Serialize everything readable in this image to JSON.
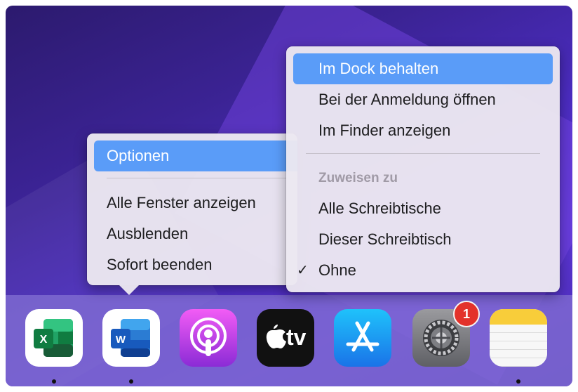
{
  "context_menu": {
    "options_label": "Optionen",
    "items": [
      "Alle Fenster anzeigen",
      "Ausblenden",
      "Sofort beenden"
    ]
  },
  "submenu": {
    "items": [
      "Im Dock behalten",
      "Bei der Anmeldung öffnen",
      "Im Finder anzeigen"
    ],
    "assign_header": "Zuweisen zu",
    "assign_items": [
      "Alle Schreibtische",
      "Dieser Schreibtisch",
      "Ohne"
    ],
    "checked_item": "Ohne"
  },
  "dock": {
    "apps": [
      {
        "name": "Excel",
        "icon": "excel-icon",
        "running": true
      },
      {
        "name": "Word",
        "icon": "word-icon",
        "running": true
      },
      {
        "name": "Podcasts",
        "icon": "podcasts-icon",
        "running": false
      },
      {
        "name": "Apple TV",
        "icon": "apple-tv-icon",
        "running": false,
        "label": "tv"
      },
      {
        "name": "App Store",
        "icon": "app-store-icon",
        "running": false
      },
      {
        "name": "Systemeinstellungen",
        "icon": "system-preferences-icon",
        "running": false,
        "badge": "1"
      },
      {
        "name": "Notizen",
        "icon": "notes-icon",
        "running": true
      }
    ]
  },
  "colors": {
    "highlight": "#5a9cf8",
    "badge": "#e3322b"
  }
}
